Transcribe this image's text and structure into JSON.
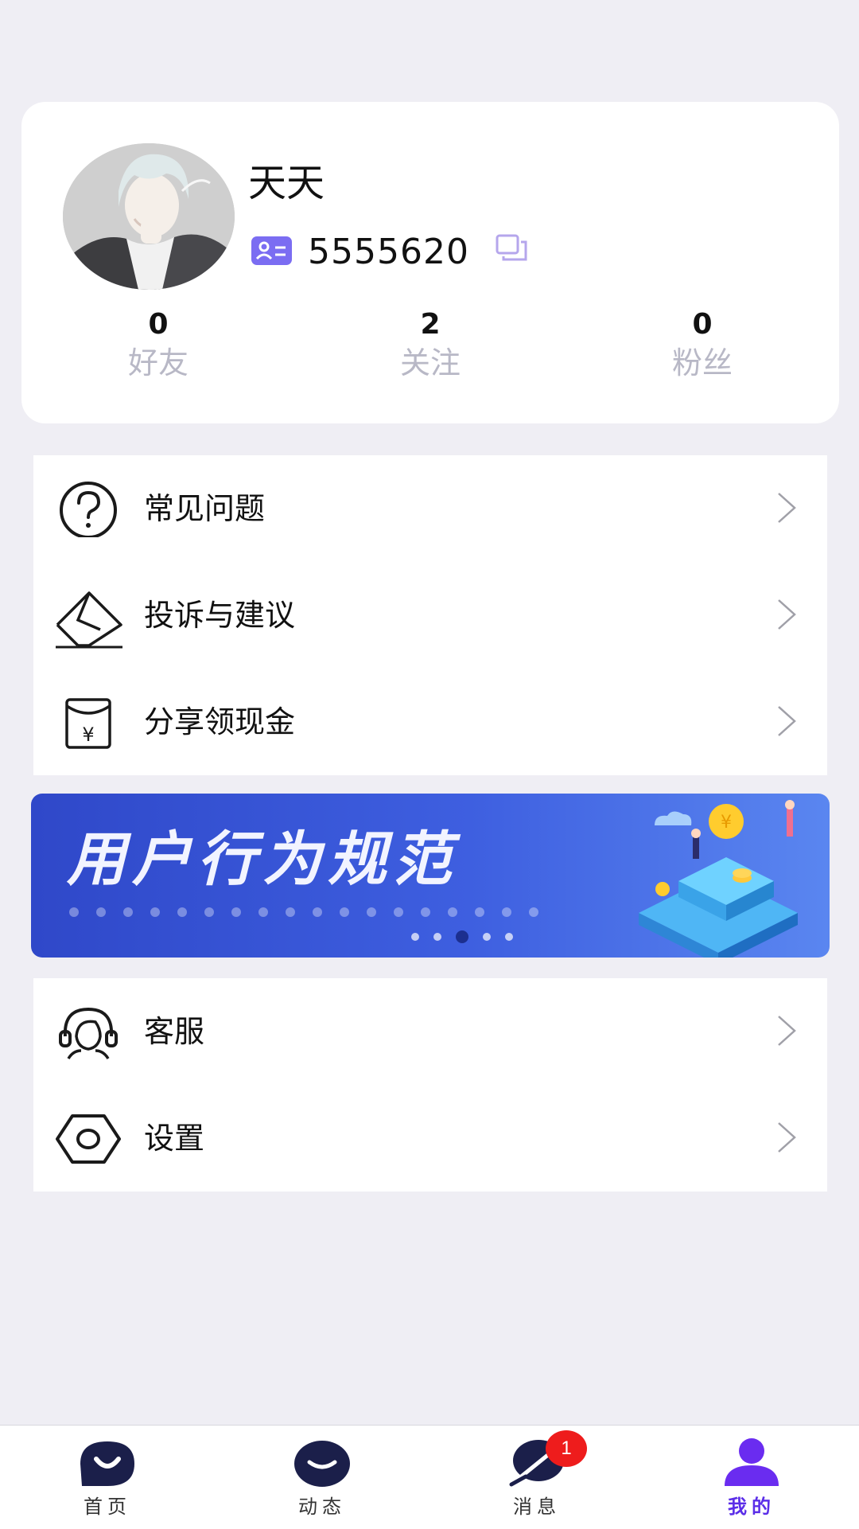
{
  "profile": {
    "username": "天天",
    "user_id": "5555620",
    "stats": [
      {
        "count": "0",
        "label": "好友"
      },
      {
        "count": "2",
        "label": "关注"
      },
      {
        "count": "0",
        "label": "粉丝"
      }
    ]
  },
  "menu_top": [
    {
      "label": "常见问题",
      "icon": "question-circle-icon"
    },
    {
      "label": "投诉与建议",
      "icon": "envelope-icon"
    },
    {
      "label": "分享领现金",
      "icon": "red-packet-icon"
    }
  ],
  "banner": {
    "title": "用户行为规范",
    "slide_count": 5,
    "active_slide": 3
  },
  "menu_bottom": [
    {
      "label": "客服",
      "icon": "headset-icon"
    },
    {
      "label": "设置",
      "icon": "hexagon-settings-icon"
    }
  ],
  "nav": {
    "items": [
      {
        "label": "首页",
        "icon": "home-icon"
      },
      {
        "label": "动态",
        "icon": "feed-icon"
      },
      {
        "label": "消息",
        "icon": "message-icon"
      },
      {
        "label": "我的",
        "icon": "profile-icon"
      }
    ],
    "active": "我的",
    "message_badge": "1"
  },
  "colors": {
    "background": "#efeef4",
    "accent": "#7b6df2",
    "active_nav": "#5b2ee8",
    "nav_icon": "#1b1f4a",
    "badge": "#ee1c1c",
    "stat_label": "#b8b8c6"
  }
}
